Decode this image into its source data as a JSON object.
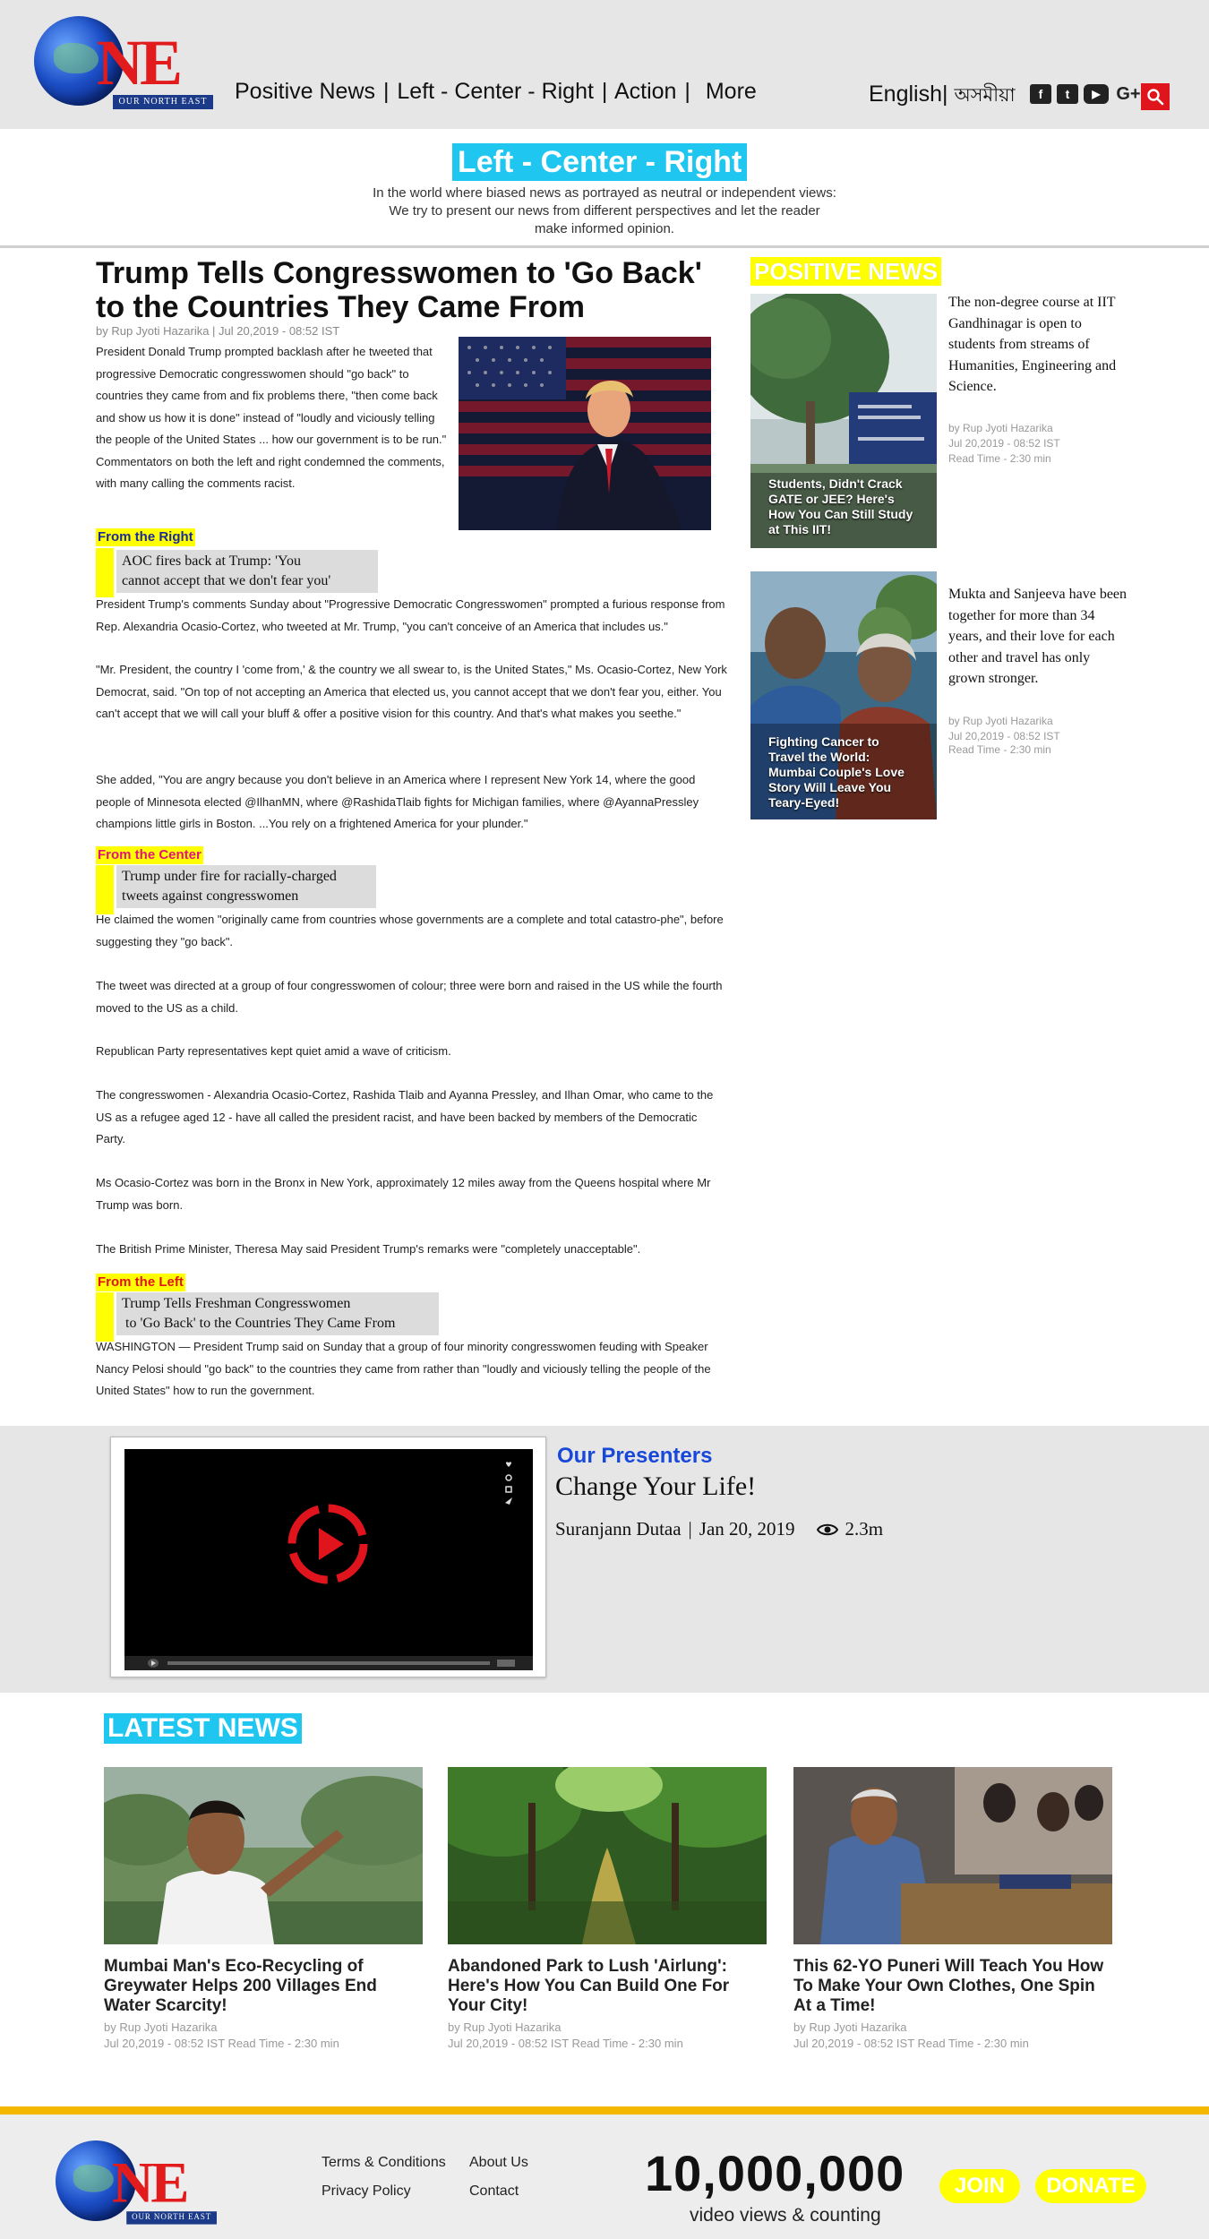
{
  "header": {
    "logo_text": "NE",
    "logo_tagline": "OUR NORTH EAST",
    "nav": [
      "Positive News",
      "Left - Center - Right",
      "Action",
      "More"
    ],
    "nav_sep": "|",
    "lang_english": "English",
    "lang_sep": "|",
    "lang_assamese": "অসমীয়া",
    "social_icons": [
      "facebook-icon",
      "twitter-icon",
      "youtube-icon",
      "google-plus-icon"
    ],
    "social_glyphs": [
      "f",
      "t",
      "▶",
      "G+"
    ],
    "search_icon": "search-icon"
  },
  "hero": {
    "title": "Left - Center - Right",
    "description": "In the world where biased news as portrayed as neutral or independent views: We try to present our news from different perspectives and let the reader make informed opinion."
  },
  "article": {
    "title": "Trump Tells Congresswomen to 'Go Back' to the Countries They Came From",
    "byline": "by Rup Jyoti Hazarika | Jul 20,2019 - 08:52 IST",
    "intro": "President Donald Trump prompted backlash after he tweeted that progressive Democratic congresswomen should \"go back\" to countries they came from and fix problems there, \"then come back and show us how it is done\" instead of \"loudly and viciously telling the people of the United States ... how our government is to be run.\" Commentators on both the left and right condemned the comments, with many calling the comments racist.",
    "right": {
      "label": "From the Right",
      "quote_line1": "AOC fires back at Trump: 'You",
      "quote_line2": "cannot accept that we don't fear you'",
      "p1": "President Trump's comments Sunday about \"Progressive Democratic Congresswomen\" prompted a furious response from Rep. Alexandria Ocasio-Cortez, who tweeted at Mr. Trump, \"you can't conceive of an America that includes us.\"",
      "p2": "\"Mr. President, the country I 'come from,' & the country we all swear to, is the United States,\" Ms. Ocasio-Cortez, New York Democrat, said. \"On top of not accepting an America that elected us, you cannot accept that we don't fear you, either. You can't accept that we will call your bluff & offer a positive vision for this country. And that's what makes you seethe.\"",
      "p3": "She added, \"You are angry because you don't believe in an America where I represent New York 14, where the good people of Minnesota elected @IlhanMN, where @RashidaTlaib fights for Michigan families, where @AyannaPressley champions little girls in Boston. ...You rely on a frightened America for your plunder.\""
    },
    "center": {
      "label": "From the Center",
      "quote_line1": "Trump under fire for racially-charged",
      "quote_line2": "tweets against congresswomen",
      "paragraphs": [
        "He claimed the women \"originally came from countries whose governments are a complete and total catastro-phe\", before suggesting they \"go back\".",
        "The tweet was directed at a group of four congresswomen of colour; three were born and raised in the US while the fourth moved to the US as a child.",
        "Republican Party representatives kept quiet amid a wave of criticism.",
        "The congresswomen - Alexandria Ocasio-Cortez, Rashida Tlaib and Ayanna Pressley, and Ilhan Omar, who came to the US as a refugee aged 12 - have all called the president racist, and have been backed by members of the Democratic Party.",
        "Ms Ocasio-Cortez was born in the Bronx in New York, approximately 12 miles away from the Queens hospital where Mr Trump was born.",
        "The British Prime Minister, Theresa May said President Trump's remarks were \"completely unacceptable\"."
      ]
    },
    "left": {
      "label": "From the Left",
      "quote_line1": "Trump Tells Freshman Congresswomen",
      "quote_line2": "to 'Go Back' to the Countries They Came From",
      "p1": "WASHINGTON — President Trump said on Sunday that a group of four minority congresswomen feuding with Speaker Nancy Pelosi should \"go back\" to the countries they came from rather than \"loudly and viciously telling the people of the United States\" how to run the government."
    }
  },
  "sidebar": {
    "label": "POSITIVE NEWS",
    "cards": [
      {
        "caption": "Students, Didn't Crack GATE or JEE? Here's How You Can Still Study at This IIT!",
        "text": "The non-degree course at IIT Gandhinagar is open to students from streams of Humanities, Engineering and Science.",
        "author": "by Rup Jyoti Hazarika",
        "date": "Jul 20,2019 - 08:52 IST",
        "read": "Read Time - 2:30 min"
      },
      {
        "caption": "Fighting Cancer to Travel the World: Mumbai Couple's Love Story Will Leave You Teary-Eyed!",
        "text": "Mukta and Sanjeeva have been together for more than 34 years, and their love for each other and travel has only grown stronger.",
        "author": "by Rup Jyoti Hazarika",
        "date": "Jul 20,2019 - 08:52 IST",
        "read": "Read Time - 2:30 min"
      }
    ]
  },
  "presenters": {
    "title": "Our Presenters",
    "subtitle": "Change Your Life!",
    "presenter": "Suranjann Dutaa",
    "sep": "|",
    "date": "Jan 20, 2019",
    "views": "2.3m"
  },
  "latest": {
    "label": "LATEST NEWS",
    "cards": [
      {
        "title": "Mumbai Man's Eco-Recycling of Greywater Helps 200 Villages End Water Scarcity!",
        "author": "by Rup Jyoti Hazarika",
        "meta": "Jul 20,2019 - 08:52 IST Read Time - 2:30 min"
      },
      {
        "title": "Abandoned Park to Lush 'Airlung': Here's How You Can Build One For Your City!",
        "author": "by Rup Jyoti Hazarika",
        "meta": "Jul 20,2019 - 08:52 IST Read Time - 2:30 min"
      },
      {
        "title": "This 62-YO Puneri Will Teach You How To Make Your Own Clothes, One Spin At a Time!",
        "author": "by Rup Jyoti Hazarika",
        "meta": "Jul 20,2019 - 08:52 IST Read Time - 2:30 min"
      }
    ]
  },
  "footer": {
    "links": [
      "Terms & Conditions",
      "About Us",
      "Privacy Policy",
      "Contact"
    ],
    "counter": "10,000,000",
    "counter_sub": "video views & counting",
    "join": "JOIN",
    "donate": "DONATE"
  },
  "colors": {
    "accent_cyan": "#1fc6f0",
    "highlight_yellow": "#ffff00",
    "brand_red": "#e21c1c",
    "footer_rule": "#f5b800",
    "right_label": "#1a2a9a",
    "center_label": "#e0147a",
    "left_label": "#e0141c"
  }
}
